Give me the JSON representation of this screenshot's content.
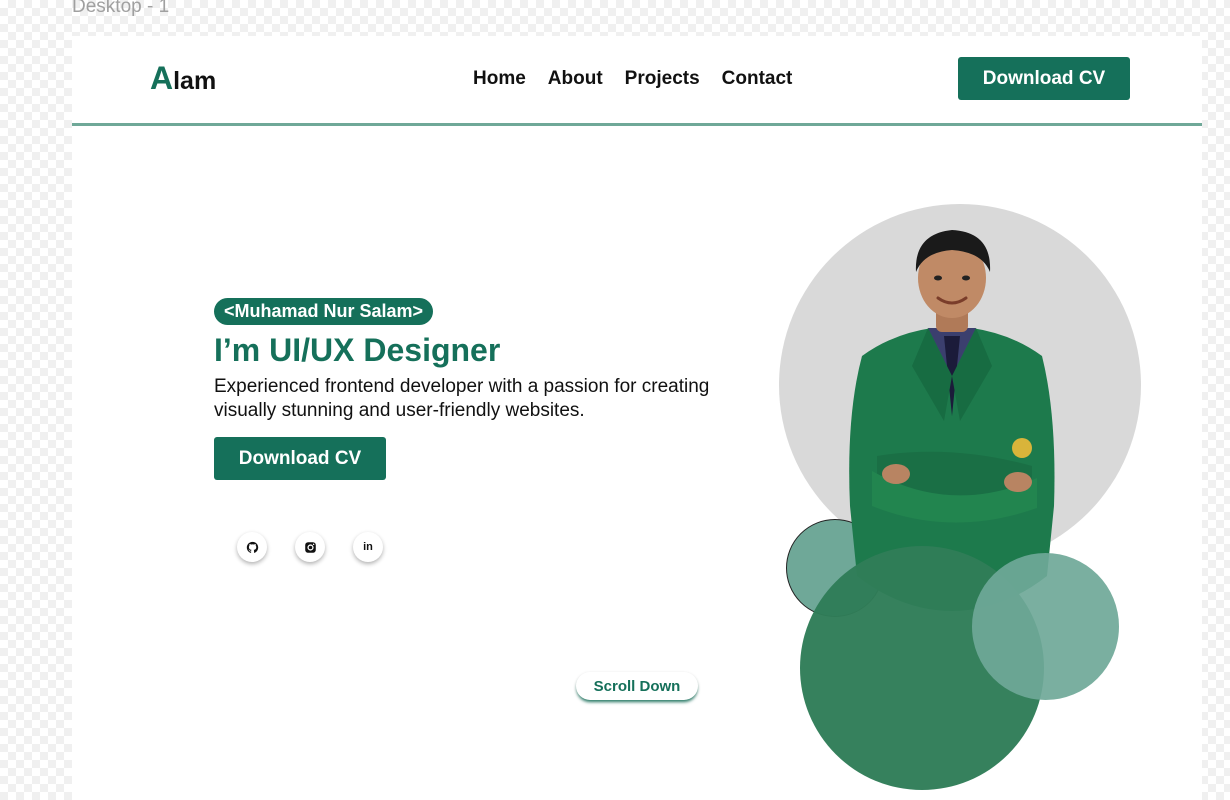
{
  "frame_label": "Desktop - 1",
  "nav": {
    "logo_initial": "A",
    "logo_rest": "lam",
    "links": [
      "Home",
      "About",
      "Projects",
      "Contact"
    ],
    "cta_label": "Download CV"
  },
  "hero": {
    "name_badge": "<Muhamad Nur Salam>",
    "headline": "I’m UI/UX Designer",
    "description": "Experienced frontend developer with a passion for creating visually stunning and user-friendly websites.",
    "cta_label": "Download CV",
    "socials": [
      {
        "name": "github",
        "icon": "github-icon"
      },
      {
        "name": "instagram",
        "icon": "instagram-icon"
      },
      {
        "name": "linkedin",
        "icon": "linkedin-icon",
        "glyph": "in"
      }
    ],
    "scroll_label": "Scroll Down"
  },
  "colors": {
    "brand": "#15705a",
    "accent_light": "#6fa898",
    "accent_dark": "#2f7d58",
    "circle_bg": "#d9d9d9"
  }
}
